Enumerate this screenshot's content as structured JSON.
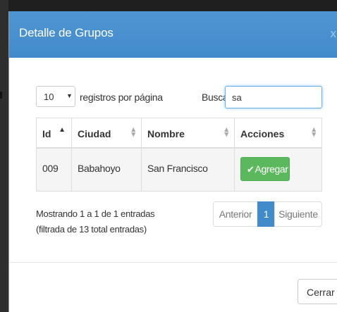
{
  "modal": {
    "title": "Detalle de Grupos",
    "close_glyph": "x"
  },
  "length": {
    "value": "10",
    "caret": "▼",
    "label": "registros por página"
  },
  "search": {
    "label": "Buscar:",
    "value": "sa"
  },
  "table": {
    "headers": [
      "Id",
      "Ciudad",
      "Nombre",
      "Acciones"
    ],
    "sorted_column": "Id",
    "rows": [
      {
        "id": "009",
        "ciudad": "Babahoyo",
        "nombre": "San Francisco",
        "action_label": "Agregar",
        "action_icon": "check-icon"
      }
    ]
  },
  "info": {
    "line1": "Mostrando 1 a 1 de 1 entradas",
    "line2": "(filtrada de 13 total entradas)"
  },
  "pagination": {
    "prev": "Anterior",
    "current": "1",
    "next": "Siguiente"
  },
  "footer": {
    "close_label": "Cerrar"
  },
  "colors": {
    "header": "#428bca",
    "success": "#5cb85c",
    "active_page": "#428bca"
  }
}
